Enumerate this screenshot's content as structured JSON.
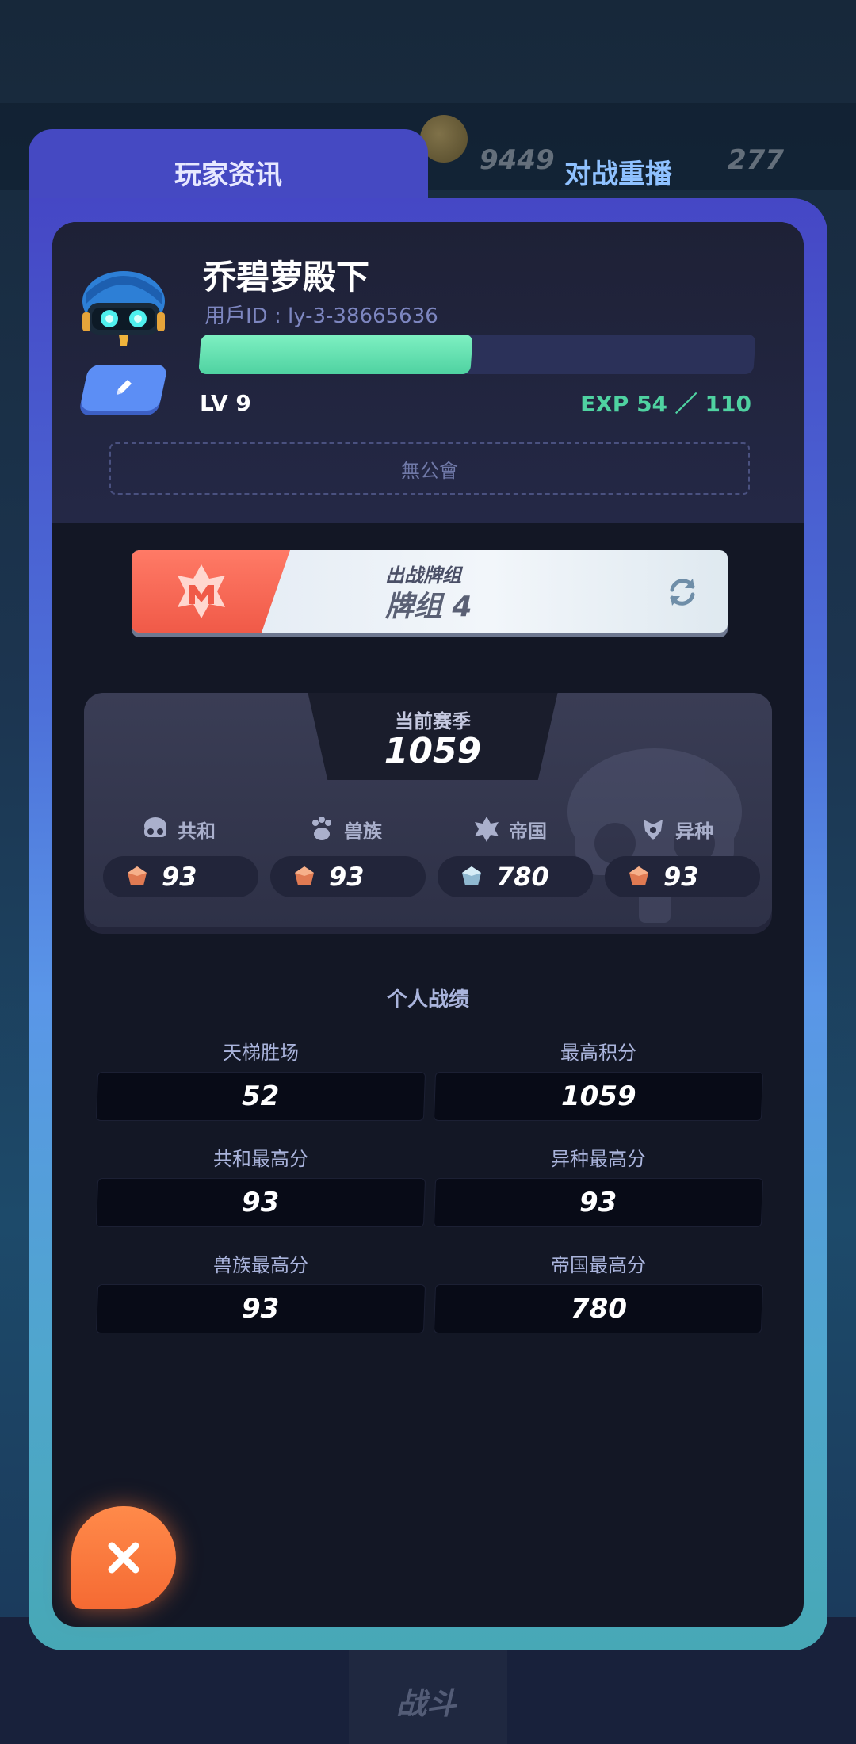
{
  "background": {
    "coins": "9449",
    "gems": "277",
    "nav_battle_label": "战斗"
  },
  "tabs": [
    {
      "label": "玩家资讯",
      "active": true
    },
    {
      "label": "对战重播",
      "active": false
    }
  ],
  "profile": {
    "name": "乔碧萝殿下",
    "user_id": "用戶ID : ly-3-38665636",
    "level": "LV 9",
    "exp_text": "EXP 54 ／ 110",
    "exp_progress": 0.49,
    "guild": "無公會"
  },
  "deck": {
    "subtitle": "出战牌组",
    "name": "牌组 4"
  },
  "season": {
    "label": "当前赛季",
    "score": "1059",
    "factions": [
      {
        "name": "共和",
        "value": "93",
        "gem": "bronze"
      },
      {
        "name": "兽族",
        "value": "93",
        "gem": "bronze"
      },
      {
        "name": "帝国",
        "value": "780",
        "gem": "silver"
      },
      {
        "name": "异种",
        "value": "93",
        "gem": "bronze"
      }
    ]
  },
  "stats": {
    "title": "个人战绩",
    "items": [
      {
        "label": "天梯胜场",
        "value": "52"
      },
      {
        "label": "最高积分",
        "value": "1059"
      },
      {
        "label": "共和最高分",
        "value": "93"
      },
      {
        "label": "异种最高分",
        "value": "93"
      },
      {
        "label": "兽族最高分",
        "value": "93"
      },
      {
        "label": "帝国最高分",
        "value": "780"
      }
    ]
  },
  "colors": {
    "accent": "#4fd2a1",
    "tab": "#4549c2",
    "close": "#f56a33"
  }
}
